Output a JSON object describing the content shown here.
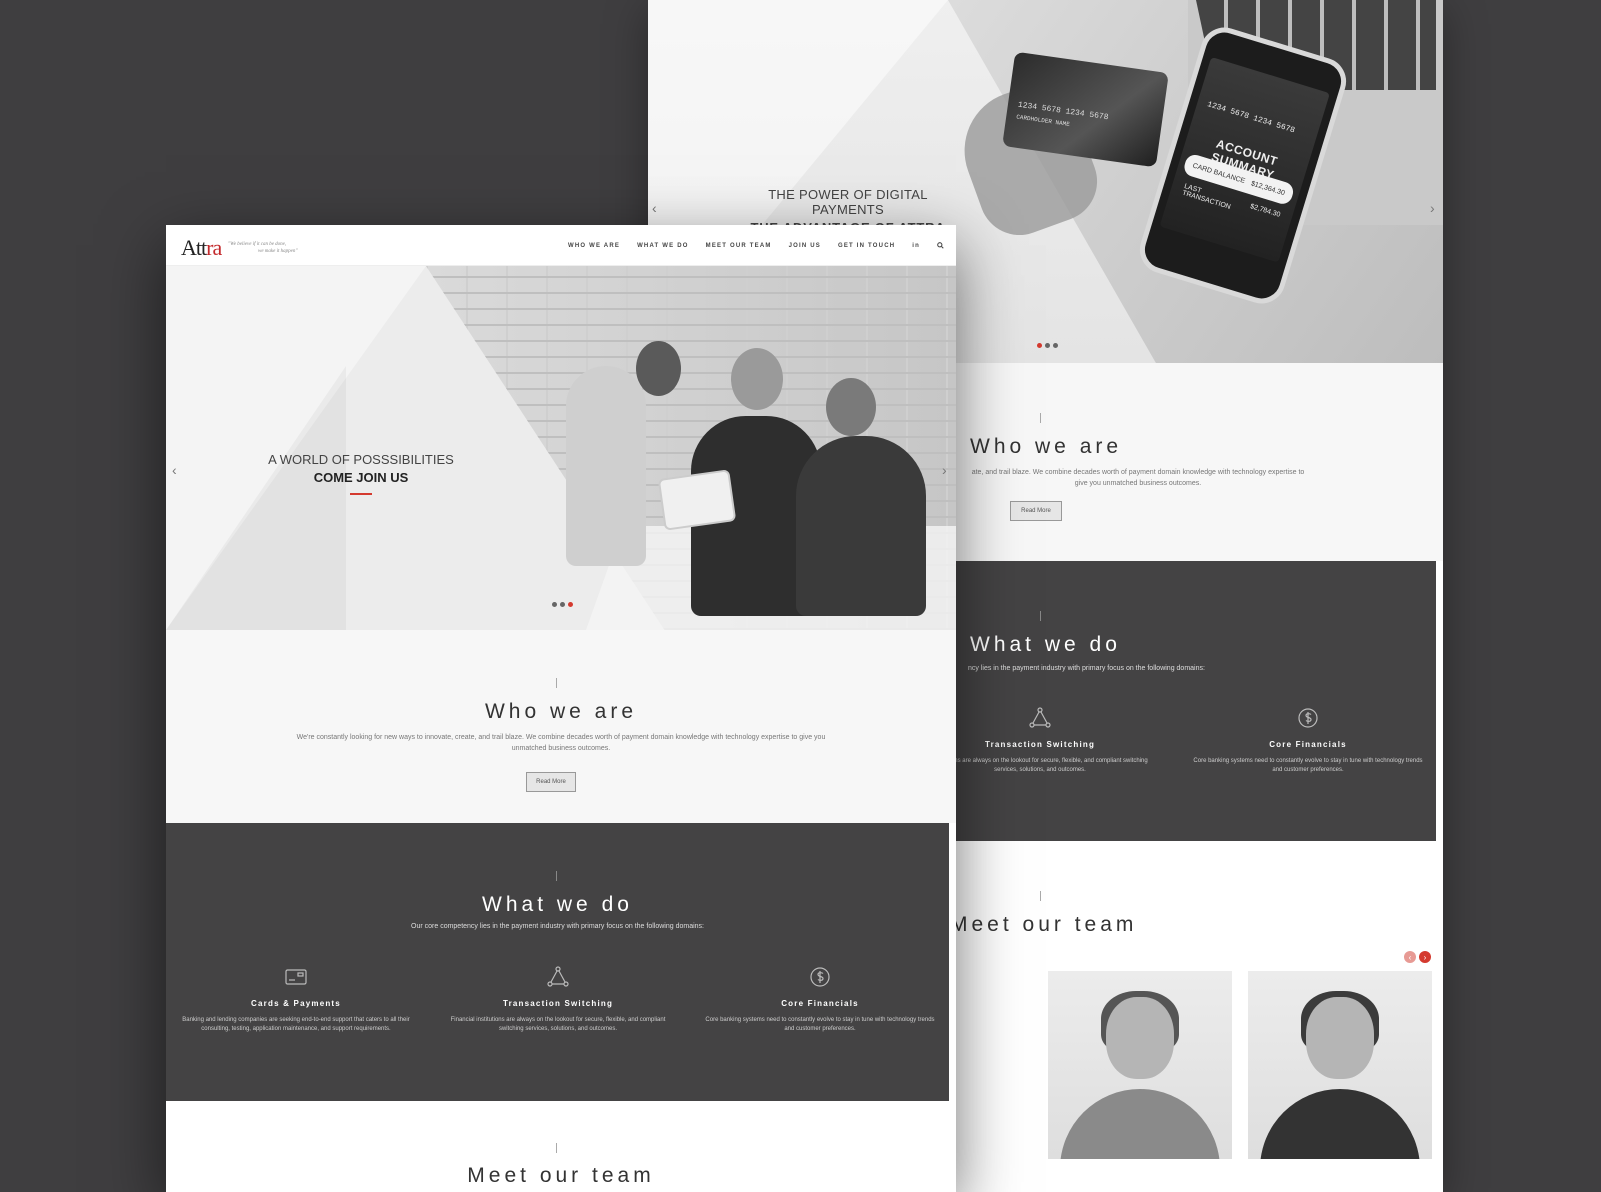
{
  "colors": {
    "accent": "#d43a2f",
    "dark": "#444344",
    "backdrop": "#3f3e40"
  },
  "back": {
    "hero": {
      "line1": "THE POWER OF DIGITAL PAYMENTS",
      "line2": "THE ADVANTAGE OF ATTRA",
      "card_numbers": "1234  5678  1234  5678",
      "card_holder": "CARDHOLDER NAME",
      "phone_title": "ACCOUNT SUMMARY",
      "card_balance_label": "CARD BALANCE",
      "card_balance_value": "$12,364.30",
      "last_tx_label": "LAST TRANSACTION",
      "last_tx_value": "$2,784.30",
      "prev_arrow": "‹",
      "next_arrow": "›"
    },
    "who": {
      "title": "Who we are",
      "text": "ate, and trail blaze. We combine decades worth of payment domain knowledge with technology expertise to give you unmatched business outcomes.",
      "button": "Read More"
    },
    "what": {
      "title": "What we do",
      "subtitle": "ncy lies in the payment industry with primary focus on the following domains:",
      "features": [
        {
          "icon": "network-icon",
          "title": "Transaction Switching",
          "text": "institutions are always on the lookout for secure, flexible, and compliant switching services, solutions, and outcomes."
        },
        {
          "icon": "dollar-coin-icon",
          "title": "Core Financials",
          "text": "Core banking systems need to constantly evolve to stay in tune with technology trends and customer preferences."
        }
      ]
    },
    "team": {
      "title": "Meet our team",
      "prev": "‹",
      "next": "›"
    }
  },
  "front": {
    "nav": {
      "logo_main": "Att",
      "logo_accent": "ra",
      "tagline_1": "\"We believe if it can be done,",
      "tagline_2": "we make it happen\"",
      "items": [
        "WHO WE ARE",
        "WHAT WE DO",
        "MEET OUR TEAM",
        "JOIN US",
        "GET IN TOUCH"
      ],
      "linkedin": "in"
    },
    "hero": {
      "line1": "A WORLD OF POSSSIBILITIES",
      "line2": "COME JOIN US",
      "prev_arrow": "‹",
      "next_arrow": "›"
    },
    "who": {
      "title": "Who we are",
      "text": "We're constantly looking for new ways to innovate, create, and trail blaze. We combine decades worth of payment domain knowledge with technology expertise to give you unmatched business outcomes.",
      "button": "Read More"
    },
    "what": {
      "title": "What we do",
      "subtitle": "Our core competency lies in the payment industry with primary focus on the following domains:",
      "features": [
        {
          "icon": "credit-card-icon",
          "title": "Cards & Payments",
          "text": "Banking and lending companies are seeking end-to-end support that caters to all their consulting, testing, application maintenance, and support requirements."
        },
        {
          "icon": "network-icon",
          "title": "Transaction Switching",
          "text": "Financial institutions are always on the lookout for secure, flexible, and compliant switching services, solutions, and outcomes."
        },
        {
          "icon": "dollar-coin-icon",
          "title": "Core Financials",
          "text": "Core banking systems need to constantly evolve to stay in tune with technology trends and customer preferences."
        }
      ]
    },
    "team": {
      "title": "Meet our team"
    }
  }
}
